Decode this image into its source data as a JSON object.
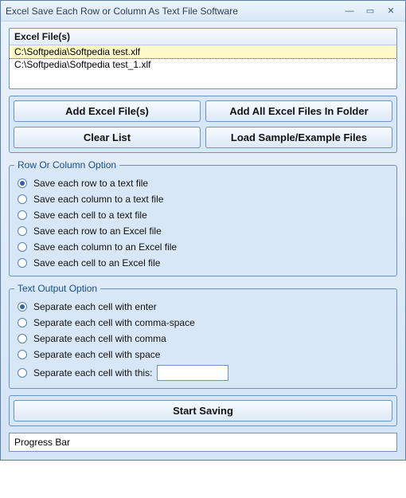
{
  "window": {
    "title": "Excel Save Each Row or Column As Text File Software"
  },
  "files": {
    "header": "Excel File(s)",
    "items": [
      "C:\\Softpedia\\Softpedia test.xlf",
      "C:\\Softpedia\\Softpedia test_1.xlf"
    ]
  },
  "buttons": {
    "add_files": "Add Excel File(s)",
    "add_folder": "Add All Excel Files In Folder",
    "clear_list": "Clear List",
    "load_sample": "Load Sample/Example Files",
    "start": "Start Saving"
  },
  "row_col_group": {
    "legend": "Row Or Column Option",
    "options": [
      "Save each row to a text file",
      "Save each column to a text file",
      "Save each cell to a text file",
      "Save each row to an Excel file",
      "Save each column to an Excel file",
      "Save each cell to an Excel file"
    ],
    "selected": 0
  },
  "text_output_group": {
    "legend": "Text Output Option",
    "options": [
      "Separate each cell with enter",
      "Separate each cell with comma-space",
      "Separate each cell with comma",
      "Separate each cell with space",
      "Separate each cell with this:"
    ],
    "selected": 0,
    "custom_value": ""
  },
  "progress": {
    "label": "Progress Bar"
  }
}
